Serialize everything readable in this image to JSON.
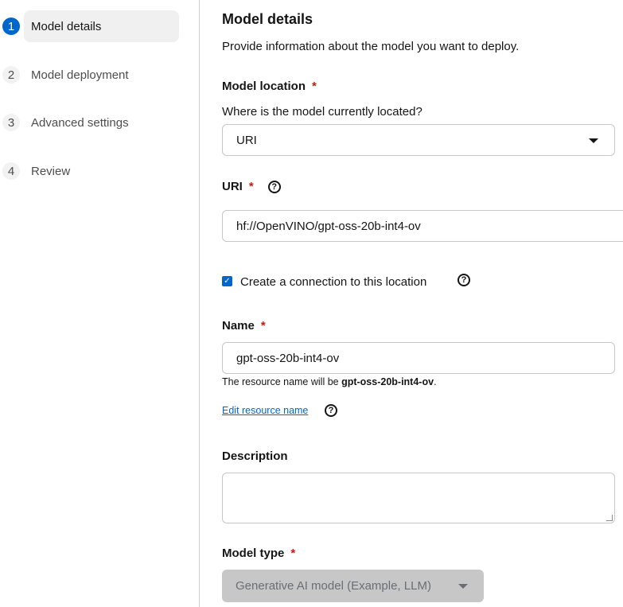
{
  "steps": [
    {
      "num": "1",
      "label": "Model details"
    },
    {
      "num": "2",
      "label": "Model deployment"
    },
    {
      "num": "3",
      "label": "Advanced settings"
    },
    {
      "num": "4",
      "label": "Review"
    }
  ],
  "form": {
    "title": "Model details",
    "subtitle": "Provide information about the model you want to deploy.",
    "model_location": {
      "label": "Model location",
      "required_mark": "*",
      "question": "Where is the model currently located?",
      "selected": "URI"
    },
    "uri": {
      "label": "URI",
      "required_mark": "*",
      "value": "hf://OpenVINO/gpt-oss-20b-int4-ov"
    },
    "connection_checkbox": {
      "label": "Create a connection to this location",
      "checked": true
    },
    "name": {
      "label": "Name",
      "required_mark": "*",
      "value": "gpt-oss-20b-int4-ov",
      "hint_prefix": "The resource name will be ",
      "hint_value": "gpt-oss-20b-int4-ov",
      "hint_suffix": "."
    },
    "edit_resource_link": "Edit resource name",
    "description": {
      "label": "Description",
      "value": ""
    },
    "model_type": {
      "label": "Model type",
      "required_mark": "*",
      "selected": "Generative AI model (Example, LLM)"
    }
  },
  "colors": {
    "accent": "#0066cc",
    "required": "#c9190b",
    "border": "#c7c7c7"
  }
}
